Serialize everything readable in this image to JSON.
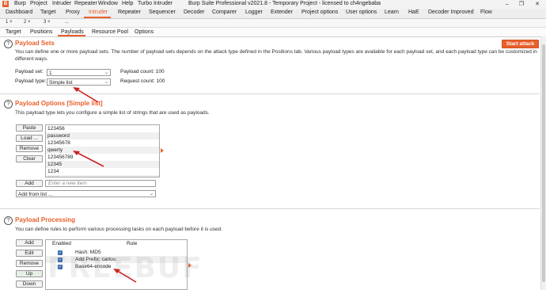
{
  "window": {
    "title": "Burp Suite Professional v2021.8 - Temporary Project - licensed to ch4ngebaba",
    "menu": [
      "Burp",
      "Project",
      "Intruder",
      "Repeater",
      "Window",
      "Help",
      "Turbo Intruder"
    ],
    "buttons": {
      "minimize": "–",
      "restore": "❐",
      "close": "✕"
    }
  },
  "main_tabs": [
    "Dashboard",
    "Target",
    "Proxy",
    "Intruder",
    "Repeater",
    "Sequencer",
    "Decoder",
    "Comparer",
    "Logger",
    "Extender",
    "Project options",
    "User options",
    "Learn",
    "HaE",
    "Decoder Improved",
    "Flow"
  ],
  "main_tab_active": "Intruder",
  "instance_tabs": [
    {
      "label": "1",
      "close": "×"
    },
    {
      "label": "2",
      "close": "×"
    },
    {
      "label": "3",
      "close": "×"
    },
    {
      "label": "...",
      "close": ""
    }
  ],
  "sub_tabs": [
    "Target",
    "Positions",
    "Payloads",
    "Resource Pool",
    "Options"
  ],
  "sub_tab_active": "Payloads",
  "help_glyph": "?",
  "payload_sets": {
    "title": "Payload Sets",
    "start_attack": "Start attack",
    "description": "You can define one or more payload sets. The number of payload sets depends on the attack type defined in the Positions tab. Various payload types are available for each payload set, and each payload type can be customized in different ways.",
    "set_label": "Payload set:",
    "set_value": "1",
    "type_label": "Payload type:",
    "type_value": "Simple list",
    "payload_count": "Payload count: 100",
    "request_count": "Request count: 100"
  },
  "payload_options": {
    "title": "Payload Options [Simple list]",
    "description": "This payload type lets you configure a simple list of strings that are used as payloads.",
    "buttons": {
      "paste": "Paste",
      "load": "Load ...",
      "remove": "Remove",
      "clear": "Clear",
      "add": "Add"
    },
    "items": [
      "123456",
      "password",
      "12345678",
      "qwerty",
      "123456789",
      "12345",
      "1234",
      "******"
    ],
    "add_placeholder": "Enter a new item",
    "add_from_list": "Add from list ..."
  },
  "payload_processing": {
    "title": "Payload Processing",
    "description": "You can define rules to perform various processing tasks on each payload before it is used.",
    "buttons": {
      "add": "Add",
      "edit": "Edit",
      "remove": "Remove",
      "up": "Up",
      "down": "Down"
    },
    "columns": {
      "enabled": "Enabled",
      "rule": "Rule"
    },
    "rules": [
      {
        "enabled": true,
        "rule": "Hash: MD5"
      },
      {
        "enabled": true,
        "rule": "Add Prefix: carlos:"
      },
      {
        "enabled": true,
        "rule": "Base64-encode"
      }
    ]
  },
  "check_glyph": "✓",
  "chevron_glyph": "⌄",
  "watermark": "FREEBUF",
  "colors": {
    "accent": "#e8602c",
    "annotation_arrow": "#cc2222",
    "checkbox": "#3b6fb6"
  }
}
